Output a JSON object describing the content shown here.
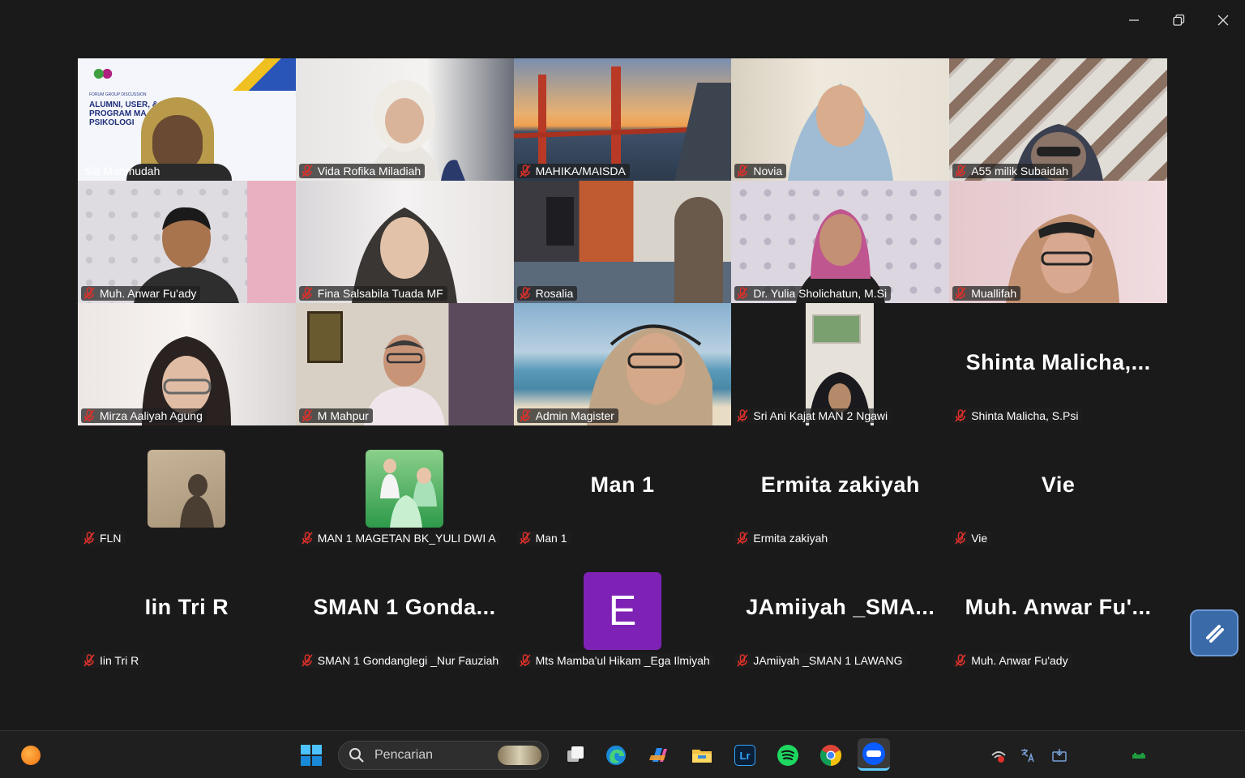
{
  "window": {
    "minimize_icon": "minimize-icon",
    "restore_icon": "restore-icon",
    "close_icon": "close-icon"
  },
  "participants": [
    {
      "name": "Siti Mahmudah",
      "type": "video",
      "active": true,
      "muted": false
    },
    {
      "name": "Vida Rofika Miladiah",
      "type": "video",
      "muted": true
    },
    {
      "name": "MAHIKA/MAISDA",
      "type": "video",
      "muted": true
    },
    {
      "name": "Novia",
      "type": "video",
      "muted": true
    },
    {
      "name": "A55 milik Subaidah",
      "type": "video",
      "muted": true
    },
    {
      "name": "Muh. Anwar Fu'ady",
      "type": "video",
      "muted": true
    },
    {
      "name": "Fina Salsabila Tuada MF",
      "type": "video",
      "muted": true
    },
    {
      "name": "Rosalia",
      "type": "video",
      "muted": true
    },
    {
      "name": "Dr. Yulia Sholichatun, M.Si",
      "type": "video",
      "muted": true
    },
    {
      "name": "Muallifah",
      "type": "video",
      "muted": true
    },
    {
      "name": "Mirza Aaliyah Agung",
      "type": "video",
      "muted": true
    },
    {
      "name": "M Mahpur",
      "type": "video",
      "muted": true
    },
    {
      "name": "Admin Magister",
      "type": "video",
      "muted": true
    },
    {
      "name": "Sri Ani Kajat MAN 2 Ngawi",
      "type": "video",
      "muted": true
    },
    {
      "name": "Shinta Malicha, S.Psi",
      "display": "Shinta  Malicha,...",
      "type": "text",
      "muted": true
    },
    {
      "name": "FLN",
      "type": "avatar",
      "muted": true
    },
    {
      "name": "MAN 1 MAGETAN BK_YULI DWI A",
      "type": "avatar",
      "muted": true
    },
    {
      "name": "Man 1",
      "display": "Man 1",
      "type": "text",
      "muted": true
    },
    {
      "name": "Ermita zakiyah",
      "display": "Ermita zakiyah",
      "type": "text",
      "muted": true
    },
    {
      "name": "Vie",
      "display": "Vie",
      "type": "text",
      "muted": true
    },
    {
      "name": "Iin Tri R",
      "display": "Iin Tri R",
      "type": "text",
      "muted": true
    },
    {
      "name": "SMAN 1 Gondanglegi _Nur Fauziah",
      "display": "SMAN  1  Gonda...",
      "type": "text",
      "muted": true
    },
    {
      "name": "Mts Mamba'ul Hikam _Ega Ilmiyah",
      "letter": "E",
      "type": "letter",
      "muted": true
    },
    {
      "name": "JAmiiyah _SMAN 1 LAWANG",
      "display": "JAmiiyah  _SMA...",
      "type": "text",
      "muted": true
    },
    {
      "name": "Muh. Anwar Fu'ady",
      "display": "Muh.  Anwar  Fu'...",
      "type": "text",
      "muted": true
    }
  ],
  "slide_text": {
    "line1": "FORUM GROUP DISCUSSION",
    "line2": "ALUMNI, USER, &",
    "line3": "PROGRAM MA",
    "line4": "PSIKOLOGI"
  },
  "taskbar": {
    "search_placeholder": "Pencarian",
    "colors": {
      "bg": "#1f1f1f",
      "accent": "#0078d4"
    }
  },
  "colors": {
    "active_speaker": "#23d959",
    "muted_red": "#e0302a",
    "letter_avatar": "#7e22b5"
  }
}
